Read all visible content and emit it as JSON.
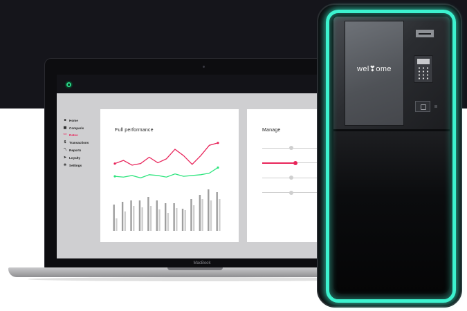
{
  "laptop": {
    "brand_label": "MacBook",
    "sidebar": {
      "items": [
        {
          "label": "Home",
          "icon": "home-icon",
          "glyph": "■",
          "active": false
        },
        {
          "label": "Comparis",
          "icon": "building-icon",
          "glyph": "▦",
          "active": false
        },
        {
          "label": "Rates",
          "icon": "trend-icon",
          "glyph": "〰",
          "active": true
        },
        {
          "label": "Transactions",
          "icon": "dollar-icon",
          "glyph": "$",
          "active": false
        },
        {
          "label": "Reports",
          "icon": "chart-line-icon",
          "glyph": "〽",
          "active": false
        },
        {
          "label": "Loyalty",
          "icon": "tag-icon",
          "glyph": "➤",
          "active": false
        },
        {
          "label": "Settings",
          "icon": "gear-icon",
          "glyph": "✲",
          "active": false
        }
      ]
    },
    "performance": {
      "title": "Full performance",
      "chart_data": {
        "type": "line",
        "series": [
          {
            "color": "#e8245a",
            "values": [
              62,
              66,
              60,
              62,
              70,
              63,
              68,
              80,
              72,
              61,
              72,
              85,
              88
            ]
          },
          {
            "color": "#2ee57e",
            "values": [
              46,
              45,
              47,
              44,
              48,
              47,
              45,
              49,
              46,
              47,
              48,
              50,
              57
            ]
          }
        ],
        "bars": [
          {
            "type": "bar",
            "a": [
              38,
              18
            ],
            "b": [
              42,
              28
            ],
            "c": [
              44,
              36
            ],
            "d": [
              44,
              34
            ],
            "e": [
              49,
              36
            ],
            "f": [
              44,
              31
            ],
            "g": [
              40,
              26
            ],
            "h": [
              40,
              33
            ],
            "i": [
              32,
              30
            ],
            "j": [
              46,
              37
            ],
            "k": [
              52,
              46
            ],
            "l": [
              60,
              44
            ],
            "m": [
              56,
              46
            ]
          },
          {
            "values_primary": [
              38,
              42,
              44,
              44,
              49,
              44,
              40,
              40,
              32,
              46,
              52,
              60,
              56
            ]
          },
          {
            "values_secondary": [
              18,
              28,
              36,
              34,
              36,
              31,
              26,
              33,
              30,
              37,
              46,
              44,
              46
            ]
          }
        ],
        "bar_colors": [
          "#9e9e9e",
          "#cfcfcf"
        ]
      }
    },
    "manage": {
      "title": "Manage",
      "sliders": [
        {
          "level": 0.32,
          "active": false
        },
        {
          "level": 0.37,
          "active": true
        },
        {
          "level": 0.32,
          "active": false
        },
        {
          "level": 0.32,
          "active": false
        }
      ]
    }
  },
  "kiosk": {
    "welcome_text": "wel❣ome",
    "glow_color": "#3cf2cf"
  }
}
